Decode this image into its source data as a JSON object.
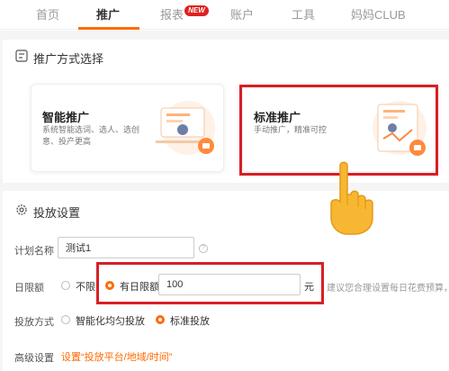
{
  "nav": {
    "items": [
      "首页",
      "推广",
      "报表",
      "账户",
      "工具",
      "妈妈CLUB"
    ],
    "active": "推广",
    "badge": "NEW"
  },
  "method_section": {
    "title": "推广方式选择",
    "options": [
      {
        "title": "智能推广",
        "desc_line1": "系统智能选词、选人、选创",
        "desc_line2": "意、投产更高"
      },
      {
        "title": "标准推广",
        "desc_line1": "手动推广，精准可控"
      }
    ]
  },
  "settings_section": {
    "title": "投放设置",
    "plan_name": {
      "label": "计划名称",
      "value": "测试1"
    },
    "daily_budget": {
      "label": "日限额",
      "option_unlimited": "不限",
      "option_limited": "有日限额",
      "value": "100",
      "unit": "元",
      "hint": "建议您合理设置每日花费预算，避免"
    },
    "delivery_method": {
      "label": "投放方式",
      "option_smart": "智能化均匀投放",
      "option_standard": "标准投放"
    },
    "advanced": {
      "label": "高级设置",
      "link": "设置“投放平台/地域/时间”"
    }
  },
  "colors": {
    "accent": "#ff6a00",
    "highlight": "#d71f26",
    "badge": "#e02020"
  }
}
